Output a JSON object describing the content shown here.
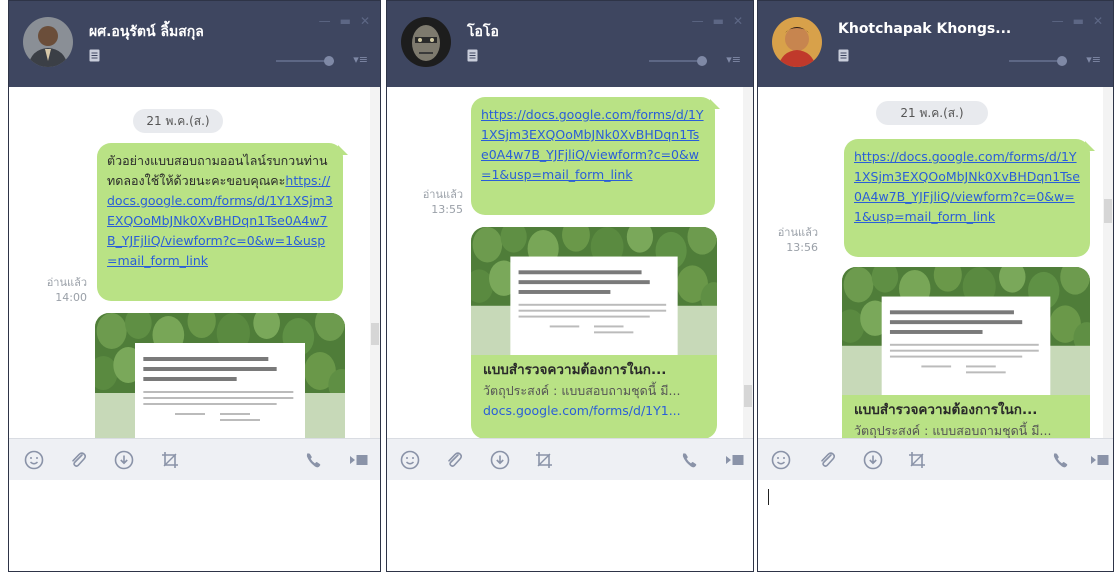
{
  "windows": [
    {
      "contact_name": "ผศ.อนุรัตน์ ลิ้มสกุล",
      "date_label": "21 พ.ค.(ส.)",
      "message_text": "ตัวอย่างแบบสอบถามออนไลน์รบกวนท่านทดลองใช้ให้ด้วยนะคะขอบคุณคะ",
      "message_link": "https://docs.google.com/forms/d/1Y1XSjm3EXQOoMbJNk0XvBHDqn1Tse0A4w7B_YJFjliQ/viewform?c=0&w=1&usp=mail_form_link",
      "read_label": "อ่านแล้ว",
      "read_time": "14:00"
    },
    {
      "contact_name": "โอโอ",
      "message_link": "https://docs.google.com/forms/d/1Y1XSjm3EXQOoMbJNk0XvBHDqn1Tse0A4w7B_YJFjliQ/viewform?c=0&w=1&usp=mail_form_link",
      "read_label": "อ่านแล้ว",
      "read_time": "13:55",
      "preview_title": "แบบสำรวจความต้องการในก...",
      "preview_desc": "วัตถุประสงค์ : แบบสอบถามชุดนี้ มี...",
      "preview_url": "docs.google.com/forms/d/1Y1..."
    },
    {
      "contact_name": "Khotchapak Khongs...",
      "date_label": "21 พ.ค.(ส.)",
      "message_link": "https://docs.google.com/forms/d/1Y1XSjm3EXQOoMbJNk0XvBHDqn1Tse0A4w7B_YJFjliQ/viewform?c=0&w=1&usp=mail_form_link",
      "read_label": "อ่านแล้ว",
      "read_time": "13:56",
      "preview_title": "แบบสำรวจความต้องการในก...",
      "preview_desc": "วัตถุประสงค์ : แบบสอบถามชุดนี้ มี..."
    }
  ],
  "icons": {
    "note": "note-icon",
    "minimize": "minimize-icon",
    "maximize": "maximize-icon",
    "close": "close-icon",
    "emoji": "emoji-icon",
    "attach": "paperclip-icon",
    "download": "download-icon",
    "crop": "crop-icon",
    "call": "phone-icon",
    "video": "video-icon"
  },
  "colors": {
    "header": "#3e4660",
    "bubble": "#b9e285",
    "link": "#2a5ed8",
    "toolbar": "#eef0f4"
  }
}
